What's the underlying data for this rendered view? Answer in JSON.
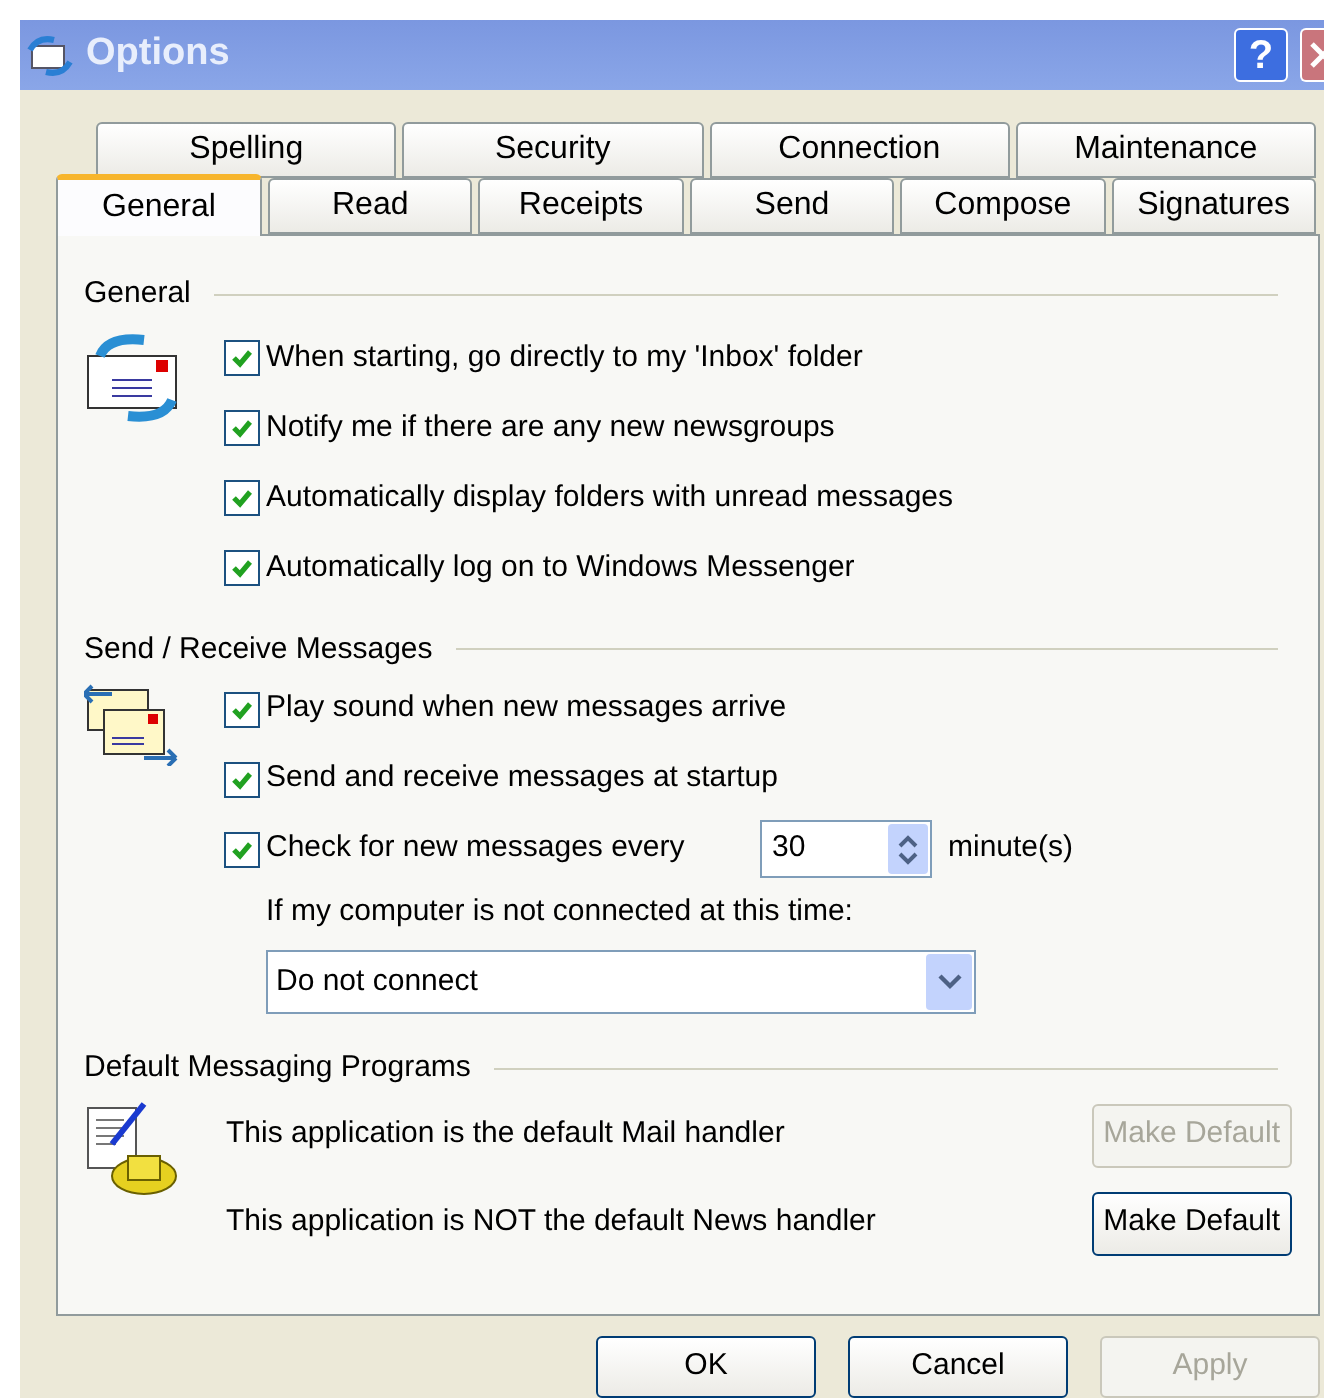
{
  "window": {
    "title": "Options",
    "help": "?"
  },
  "tab_rows": [
    [
      {
        "label": "Spelling",
        "selected": false
      },
      {
        "label": "Security",
        "selected": false
      },
      {
        "label": "Connection",
        "selected": false
      },
      {
        "label": "Maintenance",
        "selected": false
      }
    ],
    [
      {
        "label": "General",
        "selected": true
      },
      {
        "label": "Read",
        "selected": false
      },
      {
        "label": "Receipts",
        "selected": false
      },
      {
        "label": "Send",
        "selected": false
      },
      {
        "label": "Compose",
        "selected": false
      },
      {
        "label": "Signatures",
        "selected": false
      }
    ]
  ],
  "general": {
    "title": "General",
    "options": [
      {
        "label": "When starting, go directly to my 'Inbox' folder",
        "checked": true
      },
      {
        "label": "Notify me if there are any new newsgroups",
        "checked": true
      },
      {
        "label": "Automatically display folders with unread messages",
        "checked": true
      },
      {
        "label": "Automatically log on to Windows Messenger",
        "checked": true
      }
    ]
  },
  "send_receive": {
    "title": "Send / Receive Messages",
    "options": [
      {
        "label": "Play sound when new messages arrive",
        "checked": true
      },
      {
        "label": "Send and receive messages at startup",
        "checked": true
      }
    ],
    "check_every": {
      "label": "Check for new messages every",
      "checked": true,
      "value": "30",
      "unit": "minute(s)"
    },
    "not_connected_label": "If my computer is not connected at this time:",
    "not_connected_value": "Do not connect"
  },
  "default_programs": {
    "title": "Default Messaging Programs",
    "rows": [
      {
        "text": "This application is the default Mail handler",
        "button": "Make Default",
        "disabled": true
      },
      {
        "text": "This application is NOT the default News handler",
        "button": "Make Default",
        "disabled": false
      }
    ]
  },
  "buttons": [
    {
      "label": "OK",
      "disabled": false
    },
    {
      "label": "Cancel",
      "disabled": false
    },
    {
      "label": "Apply",
      "disabled": true
    }
  ]
}
